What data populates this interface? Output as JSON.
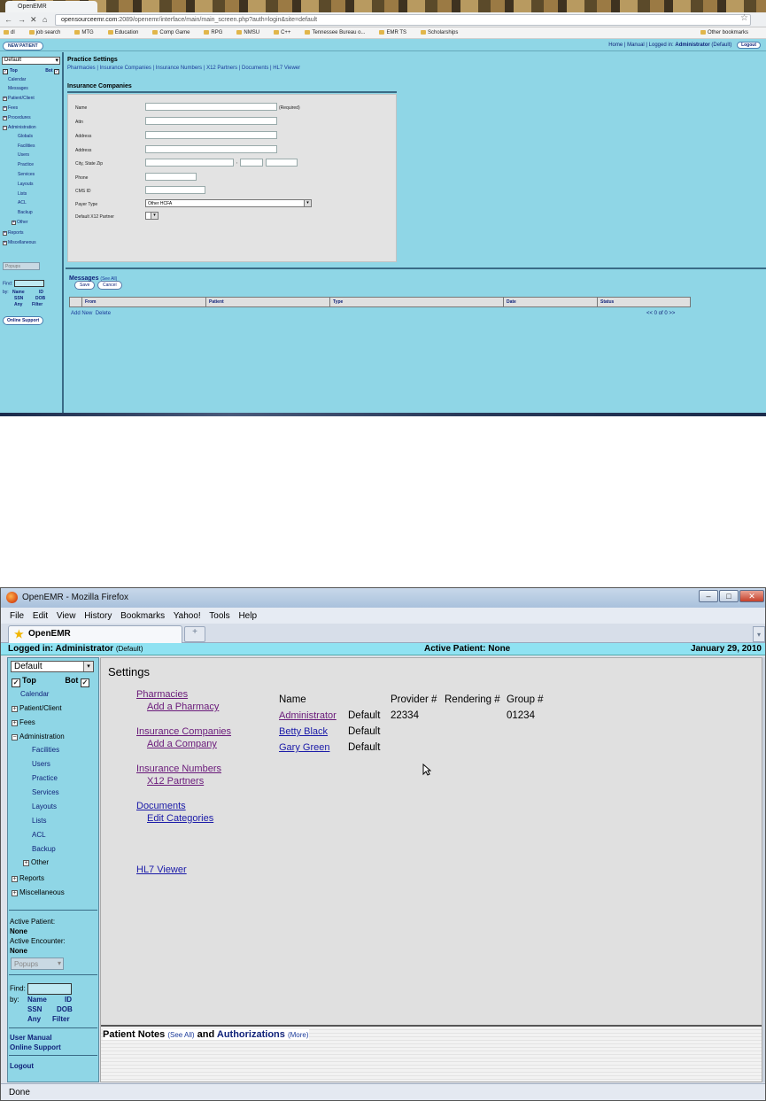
{
  "top": {
    "tab_title": "OpenEMR",
    "url_host": "opensourceemr.com",
    "url_rest": ":2089/openemr/interface/main/main_screen.php?auth=login&site=default",
    "bookmarks": [
      "dl",
      "job search",
      "MTG",
      "Education",
      "Comp Game",
      "RPG",
      "NMSU",
      "C++",
      "Tennessee Bureau o...",
      "EMR TS",
      "Scholarships"
    ],
    "other_bookmarks": "Other bookmarks",
    "new_patient": "NEW PATIENT",
    "header_right": "Home | Manual | Logged in:",
    "user": "Administrator",
    "user_site": "(Default)",
    "logout": "Logout",
    "sidebar": {
      "select": "Default",
      "top": "Top",
      "bot": "Bot",
      "items": [
        "Calendar",
        "Messages",
        "Patient/Client",
        "Fees",
        "Procedures",
        "Administration",
        "Globals",
        "Facilities",
        "Users",
        "Practice",
        "Services",
        "Layouts",
        "Lists",
        "ACL",
        "Backup",
        "Other",
        "Reports",
        "Miscellaneous"
      ],
      "popups": "Popups",
      "find": "Find:",
      "by": "by:",
      "find_opts": [
        "Name",
        "ID",
        "SSN",
        "DOB",
        "Any",
        "Filter"
      ],
      "online_support": "Online Support"
    },
    "practice_settings": "Practice Settings",
    "practice_links": "Pharmacies | Insurance Companies | Insurance Numbers | X12 Partners | Documents | HL7 Viewer",
    "ins_title": "Insurance Companies",
    "form": {
      "labels": [
        "Name",
        "Attn",
        "Address",
        "Address",
        "City, State Zip",
        "Phone",
        "CMS ID",
        "Payer Type",
        "Default X12 Partner"
      ],
      "required": "(Required)",
      "comma": ",",
      "payer_type": "Other HCFA",
      "save": "Save",
      "cancel": "Cancel"
    },
    "messages": "Messages",
    "see_all": "(See All)",
    "msg_cols": [
      "From",
      "Patient",
      "Type",
      "Date",
      "Status"
    ],
    "add_new": "Add New",
    "delete": "Delete",
    "pager": "<<  0 of 0  >>"
  },
  "bottom": {
    "window_title": "OpenEMR - Mozilla Firefox",
    "menu": [
      "File",
      "Edit",
      "View",
      "History",
      "Bookmarks",
      "Yahoo!",
      "Tools",
      "Help"
    ],
    "tab_title": "OpenEMR",
    "logged_in": "Logged in: Administrator",
    "logged_in_site": "(Default)",
    "active_patient": "Active Patient: None",
    "date": "January 29, 2010",
    "sidebar": {
      "select": "Default",
      "top": "Top",
      "bot": "Bot",
      "items": [
        "Calendar",
        "Patient/Client",
        "Fees",
        "Administration",
        "Facilities",
        "Users",
        "Practice",
        "Services",
        "Layouts",
        "Lists",
        "ACL",
        "Backup",
        "Other",
        "Reports",
        "Miscellaneous"
      ],
      "active_patient_label": "Active Patient:",
      "active_patient_value": "None",
      "active_encounter_label": "Active Encounter:",
      "active_encounter_value": "None",
      "popups": "Popups",
      "find": "Find:",
      "by": "by:",
      "find_opts": [
        "Name",
        "ID",
        "SSN",
        "DOB",
        "Any",
        "Filter"
      ],
      "user_manual": "User Manual",
      "online_support": "Online Support",
      "logout": "Logout"
    },
    "settings_title": "Settings",
    "links": {
      "pharmacies": "Pharmacies",
      "add_pharmacy": "Add a Pharmacy",
      "insurance_companies": "Insurance Companies",
      "add_company": "Add a Company",
      "insurance_numbers": "Insurance Numbers",
      "x12_partners": "X12 Partners",
      "documents": "Documents",
      "edit_categories": "Edit Categories",
      "hl7_viewer": "HL7 Viewer"
    },
    "provider_table": {
      "headers": [
        "Name",
        "Provider #",
        "Rendering #",
        "Group #"
      ],
      "rows": [
        {
          "name": "Administrator",
          "type": "Default",
          "provider": "22334",
          "group": "01234"
        },
        {
          "name": "Betty Black",
          "type": "Default",
          "provider": "",
          "group": ""
        },
        {
          "name": "Gary Green",
          "type": "Default",
          "provider": "",
          "group": ""
        }
      ]
    },
    "notes": {
      "patient_notes": "Patient Notes",
      "see_all": "(See All)",
      "and": "and",
      "authorizations": "Authorizations",
      "more": "(More)"
    },
    "status": "Done"
  }
}
